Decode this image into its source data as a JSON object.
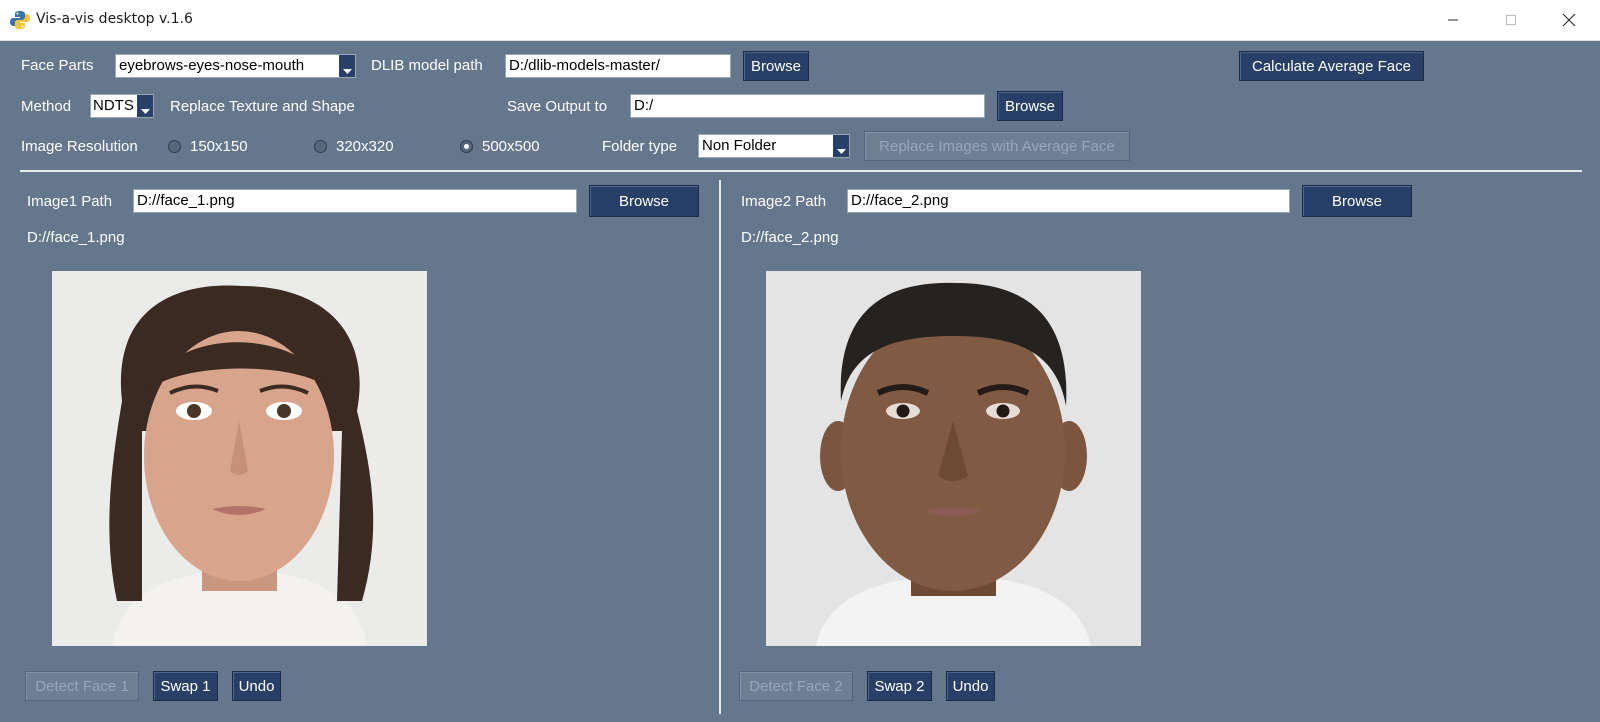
{
  "window": {
    "title": "Vis-a-vis desktop v.1.6",
    "icon": "python-icon"
  },
  "toolbar": {
    "face_parts_label": "Face Parts",
    "face_parts_value": "eyebrows-eyes-nose-mouth",
    "dlib_label": "DLIB model path",
    "dlib_value": "D:/dlib-models-master/",
    "dlib_browse": "Browse",
    "calc_avg_button": "Calculate Average Face",
    "method_label": "Method",
    "method_value": "NDTS",
    "method_description": "Replace Texture and Shape",
    "save_output_label": "Save Output to",
    "save_output_value": "D:/",
    "save_browse": "Browse",
    "resolution_label": "Image Resolution",
    "resolution_options": [
      "150x150",
      "320x320",
      "500x500"
    ],
    "resolution_selected": "500x500",
    "folder_type_label": "Folder type",
    "folder_type_value": "Non Folder",
    "replace_avg_button": "Replace Images with Average Face"
  },
  "panel1": {
    "path_label": "Image1 Path",
    "path_value": "D://face_1.png",
    "browse": "Browse",
    "path_display": "D://face_1.png",
    "detect_button": "Detect Face 1",
    "swap_button": "Swap 1",
    "undo_button": "Undo"
  },
  "panel2": {
    "path_label": "Image2 Path",
    "path_value": "D://face_2.png",
    "browse": "Browse",
    "path_display": "D://face_2.png",
    "detect_button": "Detect Face 2",
    "swap_button": "Swap 2",
    "undo_button": "Undo"
  },
  "colors": {
    "background": "#64778d",
    "button": "#283f68",
    "button_disabled": "#6e7f94"
  }
}
